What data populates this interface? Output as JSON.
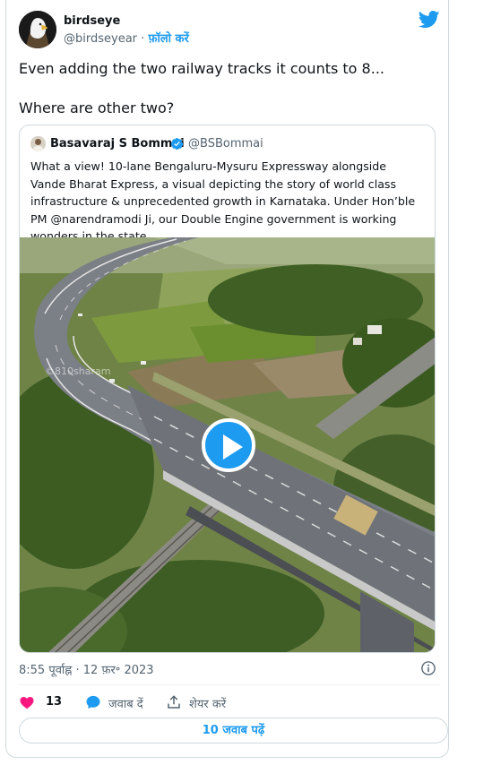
{
  "tweet": {
    "author_name": "birdseye",
    "author_handle": "@birdseyear",
    "separator": "·",
    "follow_label": "फ़ॉलो करें",
    "text": "Even adding the two railway tracks  it counts to 8...\n\nWhere are other two?",
    "timestamp": "8:55 पूर्वाह्न · 12 फ़र॰ 2023",
    "likes": "13",
    "reply_label": "जवाब दें",
    "share_label": "शेयर करें",
    "read_replies_label": "10 जवाब पढ़ें"
  },
  "quoted": {
    "author_name": "Basavaraj S Bommai",
    "author_handle": "@BSBommai",
    "text": "What a view! 10-lane Bengaluru-Mysuru Expressway alongside Vande Bharat Express, a visual depicting the story of world class infrastructure & unprecedented growth in Karnataka. Under Hon’ble PM @narendramodi Ji, our Double Engine government is working wonders in the state.",
    "watermark": "©810sharam"
  },
  "icons": {
    "brand": "twitter-bird-icon",
    "verified": "verified-badge-icon",
    "play": "play-icon",
    "info": "info-icon",
    "like": "heart-icon",
    "reply": "speech-bubble-icon",
    "share": "share-icon"
  },
  "colors": {
    "accent": "#1d9bf0",
    "like": "#f91880",
    "text": "#0f1419",
    "muted": "#536471",
    "border": "#cfd9de"
  }
}
